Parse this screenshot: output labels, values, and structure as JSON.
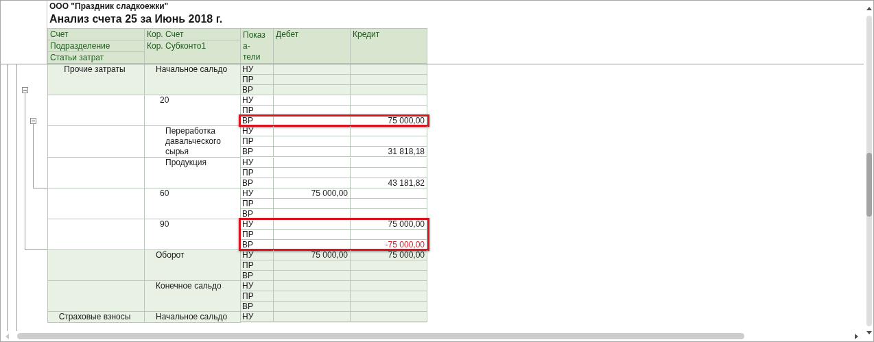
{
  "report": {
    "company": "ООО \"Праздник сладкоежки\"",
    "title": "Анализ счета 25 за Июнь 2018 г."
  },
  "columns": {
    "account_levels": [
      "Счет",
      "Подразделение",
      "Статьи затрат"
    ],
    "corr_levels": [
      "Кор. Счет",
      "Кор. Субконто1"
    ],
    "indicator": [
      "Показ",
      "а-",
      "тели"
    ],
    "debit": "Дебет",
    "credit": "Кредит"
  },
  "outline": [
    {
      "expanded": true
    },
    {
      "expanded": true
    }
  ],
  "groups": [
    {
      "kind": "total",
      "account": "Прочие затраты",
      "corr": "Начальное сальдо",
      "rows": [
        {
          "indicator": "НУ",
          "highlighted": false
        },
        {
          "indicator": "ПР",
          "highlighted": false
        },
        {
          "indicator": "ВР",
          "highlighted": false
        }
      ]
    },
    {
      "kind": "account",
      "corr": "20",
      "rows": [
        {
          "indicator": "НУ",
          "highlighted": false
        },
        {
          "indicator": "ПР",
          "highlighted": false
        },
        {
          "indicator": "ВР",
          "credit": "75 000,00",
          "highlighted": true,
          "negative": false
        }
      ]
    },
    {
      "kind": "subconto",
      "corr": "Переработка давальческого сырья",
      "rows": [
        {
          "indicator": "НУ",
          "highlighted": false
        },
        {
          "indicator": "ПР",
          "highlighted": false
        },
        {
          "indicator": "ВР",
          "credit": "31 818,18",
          "highlighted": false,
          "negative": false
        }
      ]
    },
    {
      "kind": "subconto",
      "corr": "Продукция",
      "rows": [
        {
          "indicator": "НУ",
          "highlighted": false
        },
        {
          "indicator": "ПР",
          "highlighted": false
        },
        {
          "indicator": "ВР",
          "credit": "43 181,82",
          "highlighted": false,
          "negative": false
        }
      ]
    },
    {
      "kind": "account",
      "corr": "60",
      "rows": [
        {
          "indicator": "НУ",
          "debit": "75 000,00",
          "highlighted": false
        },
        {
          "indicator": "ПР",
          "highlighted": false
        },
        {
          "indicator": "ВР",
          "highlighted": false
        }
      ]
    },
    {
      "kind": "account",
      "corr": "90",
      "rows": [
        {
          "indicator": "НУ",
          "credit": "75 000,00",
          "highlighted": true,
          "negative": false
        },
        {
          "indicator": "ПР",
          "highlighted": true
        },
        {
          "indicator": "ВР",
          "credit": "-75 000,00",
          "highlighted": true,
          "negative": true
        }
      ]
    },
    {
      "kind": "total",
      "corr": "Оборот",
      "rows": [
        {
          "indicator": "НУ",
          "debit": "75 000,00",
          "credit": "75 000,00",
          "highlighted": false,
          "negative": false
        },
        {
          "indicator": "ПР",
          "highlighted": false
        },
        {
          "indicator": "ВР",
          "highlighted": false
        }
      ]
    },
    {
      "kind": "total",
      "corr": "Конечное сальдо",
      "rows": [
        {
          "indicator": "НУ",
          "highlighted": false
        },
        {
          "indicator": "ПР",
          "highlighted": false
        },
        {
          "indicator": "ВР",
          "highlighted": false
        }
      ]
    },
    {
      "kind": "total",
      "account": "Страховые взносы",
      "corr": "Начальное сальдо",
      "rows": [
        {
          "indicator": "НУ",
          "highlighted": false
        }
      ]
    }
  ]
}
